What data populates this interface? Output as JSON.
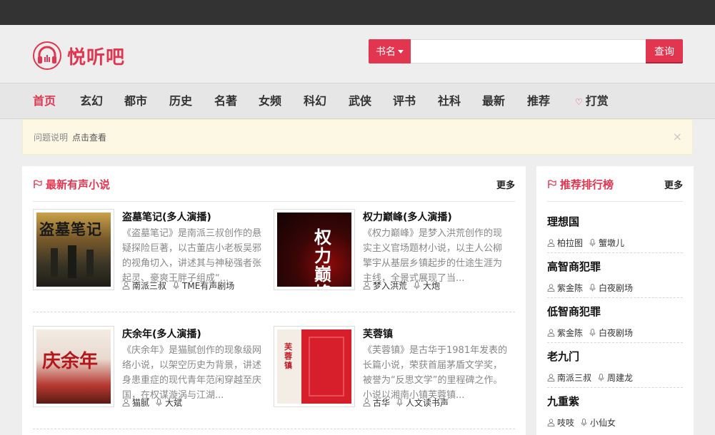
{
  "brand": {
    "name": "悦听吧",
    "color": "#e2354f",
    "logo_icon": "headphones-icon"
  },
  "search": {
    "category_label": "书名",
    "input_value": "",
    "button_label": "查询"
  },
  "nav": {
    "items": [
      "首页",
      "玄幻",
      "都市",
      "历史",
      "名著",
      "女频",
      "科幻",
      "武侠",
      "评书",
      "社科",
      "最新",
      "推荐"
    ],
    "active_index": 0,
    "tip_label": "打赏",
    "tip_icon": "heart-icon"
  },
  "notice": {
    "text": "问题说明",
    "link": "点击查看",
    "close": "×"
  },
  "latest": {
    "title": "最新有声小说",
    "more": "更多",
    "books": [
      {
        "title": "盗墓笔记(多人演播)",
        "desc": "《盗墓笔记》是南派三叔创作的悬疑探险巨著，以古董店小老板吴邪的视角切入，讲述其与神秘强者张起灵、豪爽王胖子组成“...",
        "author": "南派三叔",
        "narrator": "TME有声剧场",
        "cover_text": "盗墓笔记"
      },
      {
        "title": "权力巅峰(多人演播)",
        "desc": "《权力巅峰》是梦入洪荒创作的现实主义官场题材小说，以主人公柳擎宇从基层乡镇起步的仕途生涯为主线，全景式展现了当...",
        "author": "梦入洪荒",
        "narrator": "大炮",
        "cover_text": "权力巅峰"
      },
      {
        "title": "庆余年(多人演播)",
        "desc": "《庆余年》是猫腻创作的现象级网络小说，以架空历史为背景，讲述身患重症的现代青年范闲穿越至庆国，在权谋漩涡与江湖...",
        "author": "猫腻",
        "narrator": "大斌",
        "cover_text": "庆余年"
      },
      {
        "title": "芙蓉镇",
        "desc": "《芙蓉镇》是古华于1981年发表的长篇小说，荣获首届茅盾文学奖，被誉为“反思文学”的里程碑之作。小说以湘南小镇芙蓉镇...",
        "author": "古华",
        "narrator": "人文读书声",
        "cover_text": "芙蓉镇"
      }
    ]
  },
  "ranking": {
    "title": "推荐排行榜",
    "more": "更多",
    "items": [
      {
        "title": "理想国",
        "author": "柏拉图",
        "narrator": "蟹墩儿"
      },
      {
        "title": "高智商犯罪",
        "author": "紫金陈",
        "narrator": "白夜剧场"
      },
      {
        "title": "低智商犯罪",
        "author": "紫金陈",
        "narrator": "白夜剧场"
      },
      {
        "title": "老九门",
        "author": "南派三叔",
        "narrator": "周建龙"
      },
      {
        "title": "九重紫",
        "author": "吱吱",
        "narrator": "小仙女"
      }
    ]
  },
  "icons": {
    "author": "person-icon",
    "narrator": "microphone-icon",
    "section": "flag-icon"
  }
}
